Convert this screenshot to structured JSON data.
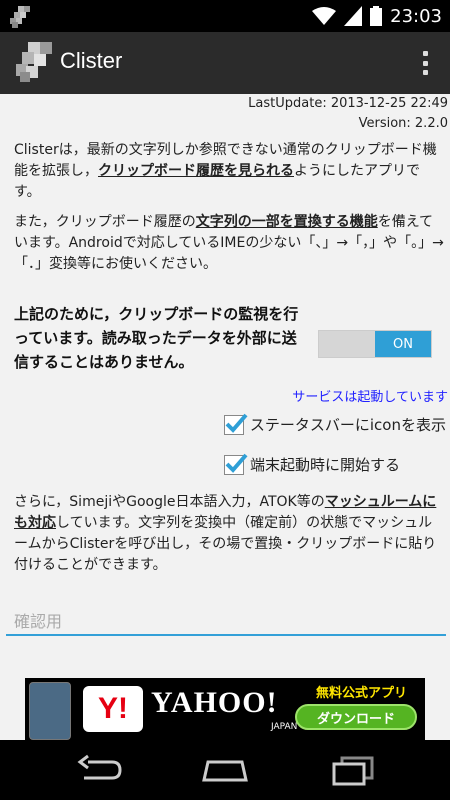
{
  "status_bar": {
    "time": "23:03"
  },
  "action_bar": {
    "title": "Clister"
  },
  "meta": {
    "last_update": "LastUpdate: 2013-12-25 22:49",
    "version": "Version: 2.2.0"
  },
  "description": {
    "p1_before": "Clisterは，最新の文字列しか参照できない通常のクリップボード機能を拡張し，",
    "p1_link": "クリップボード履歴を見られる",
    "p1_after": "ようにしたアプリです。",
    "p2_before": "また，クリップボード履歴の",
    "p2_link": "文字列の一部を置換する機能",
    "p2_after": "を備えています。Androidで対応しているIMEの少ない「、」→「，」や「。」→「．」変換等にお使いください。",
    "p3": "上記のために，クリップボードの監視を行っています。読み取ったデータを外部に送信することはありません。",
    "p4_before": "さらに，SimejiやGoogle日本語入力，ATOK等の",
    "p4_link": "マッシュルームにも対応",
    "p4_after": "しています。文字列を変換中（確定前）の状態でマッシュルームからClisterを呼び出し，その場で置換・クリップボードに貼り付けることができます。"
  },
  "toggle": {
    "label": "ON",
    "checked": true
  },
  "service_status": "サービスは起動しています",
  "checkboxes": [
    {
      "label": "ステータスバーにiconを表示",
      "checked": true
    },
    {
      "label": "端末起動時に開始する",
      "checked": true
    }
  ],
  "confirm_input": {
    "placeholder": "確認用",
    "value": ""
  },
  "ad": {
    "brand": "YAHOO!",
    "brand_sub": "JAPAN",
    "logo_letter": "Y!",
    "badge": "無料公式アプリ",
    "cta": "ダウンロード"
  },
  "colors": {
    "accent": "#2f9fd6",
    "service_text": "#2222ff",
    "action_bar": "#2b2b2b",
    "content_bg": "#f2f2f2"
  },
  "icons": [
    "notification-icon",
    "wifi-icon",
    "signal-icon",
    "battery-icon",
    "app-icon",
    "overflow-menu-icon",
    "checkmark-icon",
    "back-icon",
    "home-icon",
    "recent-apps-icon"
  ]
}
